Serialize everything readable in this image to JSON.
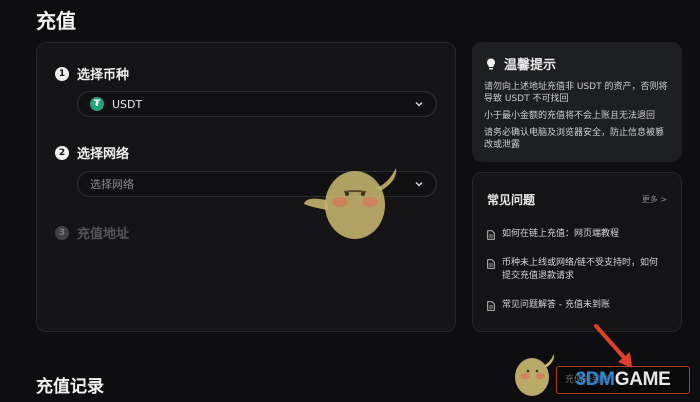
{
  "page": {
    "title": "充值"
  },
  "steps": [
    {
      "num": "1",
      "label": "选择币种"
    },
    {
      "num": "2",
      "label": "选择网络"
    },
    {
      "num": "3",
      "label": "充值地址"
    }
  ],
  "coin_select": {
    "value": "USDT",
    "icon": "tether-icon",
    "icon_color": "#26a17b"
  },
  "network_select": {
    "placeholder": "选择网络"
  },
  "tips": {
    "title": "温馨提示",
    "items": [
      "请勿向上述地址充值非 USDT 的资产，否则将导致 USDT 不可找回",
      "小于最小金额的充值将不会上账且无法退回",
      "请务必确认电脑及浏览器安全，防止信息被篡改或泄露"
    ]
  },
  "faq": {
    "title": "常见问题",
    "more": "更多 >",
    "items": [
      "如何在链上充值：网页端教程",
      "币种未上线或网络/链不受支持时，如何提交充值退款请求",
      "常见问题解答 - 充值未到账"
    ]
  },
  "records": {
    "title": "充值记录"
  },
  "bottom_link": "充值未到账",
  "watermark": {
    "prefix": "3DM",
    "suffix": "GAME"
  },
  "colors": {
    "background": "#0e0e10",
    "panel": "#141416",
    "tips_panel": "#1d1e21",
    "annotation_arrow": "#e0402a"
  }
}
